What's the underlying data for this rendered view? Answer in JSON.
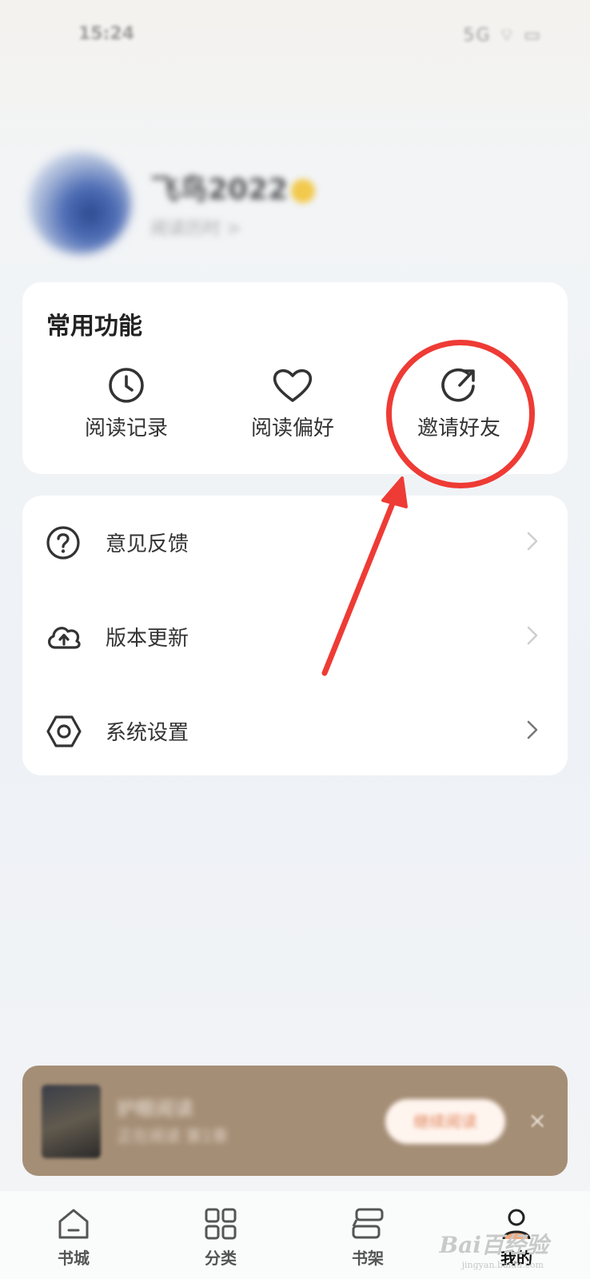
{
  "status_bar": {
    "time": "15:24",
    "icons_text": "5G ⌔ ▭"
  },
  "profile": {
    "username": "飞鸟2022",
    "subtitle": "阅读历时 >"
  },
  "common_functions": {
    "title": "常用功能",
    "items": [
      {
        "label": "阅读记录",
        "icon": "clock-icon"
      },
      {
        "label": "阅读偏好",
        "icon": "heart-icon"
      },
      {
        "label": "邀请好友",
        "icon": "share-icon"
      }
    ]
  },
  "menu": {
    "items": [
      {
        "label": "意见反馈",
        "icon": "question-icon"
      },
      {
        "label": "版本更新",
        "icon": "cloud-upload-icon"
      },
      {
        "label": "系统设置",
        "icon": "settings-hex-icon"
      }
    ]
  },
  "mini_player": {
    "title": "护眼阅读",
    "subtitle": "正在阅读 第1章",
    "button": "继续阅读",
    "close": "×"
  },
  "tabs": [
    {
      "label": "书城",
      "icon": "home-icon"
    },
    {
      "label": "分类",
      "icon": "grid-icon"
    },
    {
      "label": "书架",
      "icon": "bookshelf-icon"
    },
    {
      "label": "我的",
      "icon": "user-icon"
    }
  ],
  "watermark": {
    "logo": "Bai百经验",
    "sub": "jingyan.baidu.com"
  },
  "colors": {
    "accent_red": "#ee3b35",
    "player_bg": "#a58e76",
    "card_bg": "#ffffff"
  }
}
